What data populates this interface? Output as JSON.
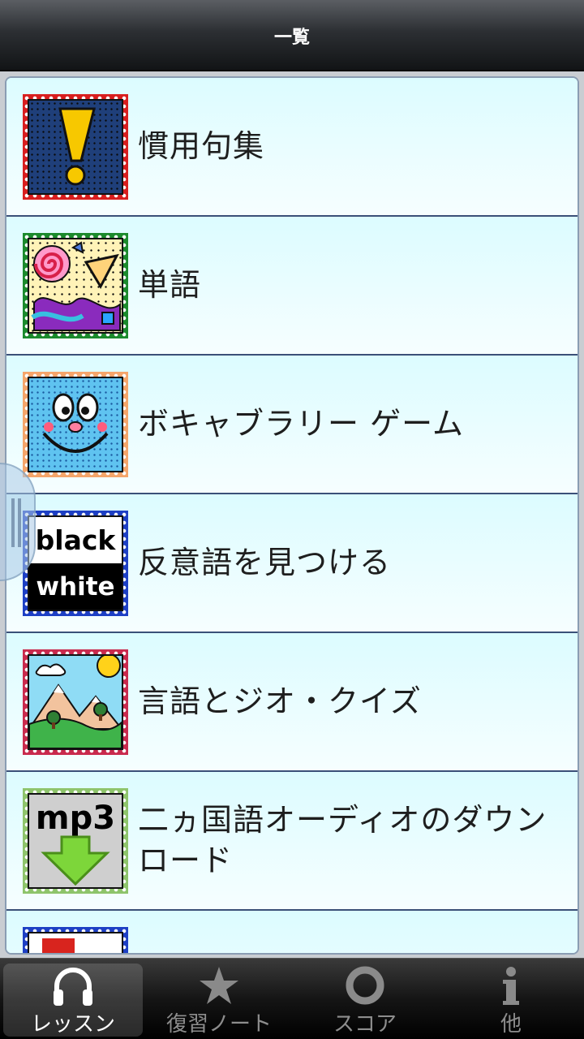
{
  "header": {
    "title": "一覧"
  },
  "lessons": [
    {
      "label": "慣用句集",
      "icon": "exclamation-stamp-icon"
    },
    {
      "label": "単語",
      "icon": "shapes-stamp-icon"
    },
    {
      "label": "ボキャブラリー ゲーム",
      "icon": "smiley-face-stamp-icon"
    },
    {
      "label": "反意語を見つける",
      "icon": "black-white-stamp-icon",
      "icon_text": [
        "black",
        "white"
      ]
    },
    {
      "label": "言語とジオ・クイズ",
      "icon": "mountain-landscape-stamp-icon"
    },
    {
      "label": "二ヵ国語オーディオのダウンロード",
      "icon": "mp3-download-stamp-icon",
      "icon_text": [
        "mp3"
      ]
    },
    {
      "label": "",
      "icon": "partial-stamp-icon"
    }
  ],
  "tabs": [
    {
      "label": "レッスン",
      "icon": "headphones-icon",
      "active": true
    },
    {
      "label": "復習ノート",
      "icon": "star-icon",
      "active": false
    },
    {
      "label": "スコア",
      "icon": "ring-icon",
      "active": false
    },
    {
      "label": "他",
      "icon": "info-icon",
      "active": false
    }
  ]
}
